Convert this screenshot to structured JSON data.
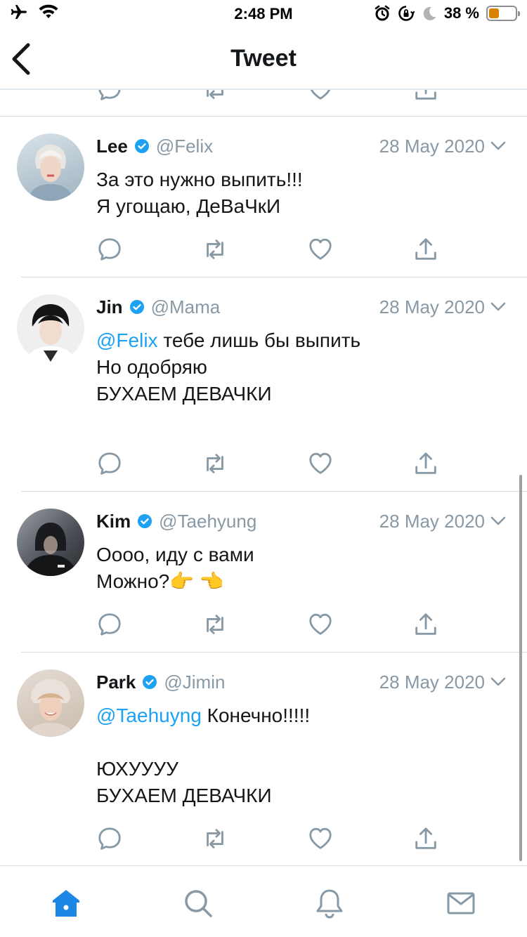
{
  "status_bar": {
    "time": "2:48 PM",
    "battery_percent": "38 %",
    "battery_level": 0.38,
    "icons": [
      "airplane-icon",
      "wifi-icon",
      "alarm-icon",
      "orientation-lock-icon",
      "moon-icon",
      "battery-icon"
    ]
  },
  "nav": {
    "title": "Tweet",
    "back_icon": "chevron-left-icon"
  },
  "tweets": [
    {
      "name": "Lee",
      "handle": "@Felix",
      "date": "28 May 2020",
      "mention": "",
      "text": "За это нужно выпить!!!\nЯ угощаю, ДеВаЧкИ",
      "avatar_colors": [
        "#c9d4dc",
        "#e8d9d0"
      ]
    },
    {
      "name": "Jin",
      "handle": "@Mama",
      "date": "28 May 2020",
      "mention": "@Felix",
      "text": " тебе лишь бы выпить\nНо одобряю\nБУХАЕМ ДЕВАЧКИ",
      "avatar_colors": [
        "#1b1b1b",
        "#f0d9c8"
      ]
    },
    {
      "name": "Kim",
      "handle": "@Taehyung",
      "date": "28 May 2020",
      "mention": "",
      "text": "Оооо, иду с вами\nМожно?👉 👈",
      "avatar_colors": [
        "#2a2c30",
        "#c8ccd0"
      ]
    },
    {
      "name": "Park",
      "handle": "@Jimin",
      "date": "28 May 2020",
      "mention": "@Taehuyng",
      "text": " Конечно!!!!!\n\nЮХУУУУ\nБУХАЕМ ДЕВАЧКИ",
      "avatar_colors": [
        "#d8c8b8",
        "#f2d2c0"
      ]
    }
  ],
  "colors": {
    "accent": "#1da1f2",
    "muted": "#8899a6",
    "text": "#14171a",
    "divider": "#d6dbe0",
    "tab_active": "#1d87e5"
  },
  "tabs": [
    {
      "name": "home-icon",
      "active": true
    },
    {
      "name": "search-icon",
      "active": false
    },
    {
      "name": "bell-icon",
      "active": false
    },
    {
      "name": "mail-icon",
      "active": false
    }
  ]
}
